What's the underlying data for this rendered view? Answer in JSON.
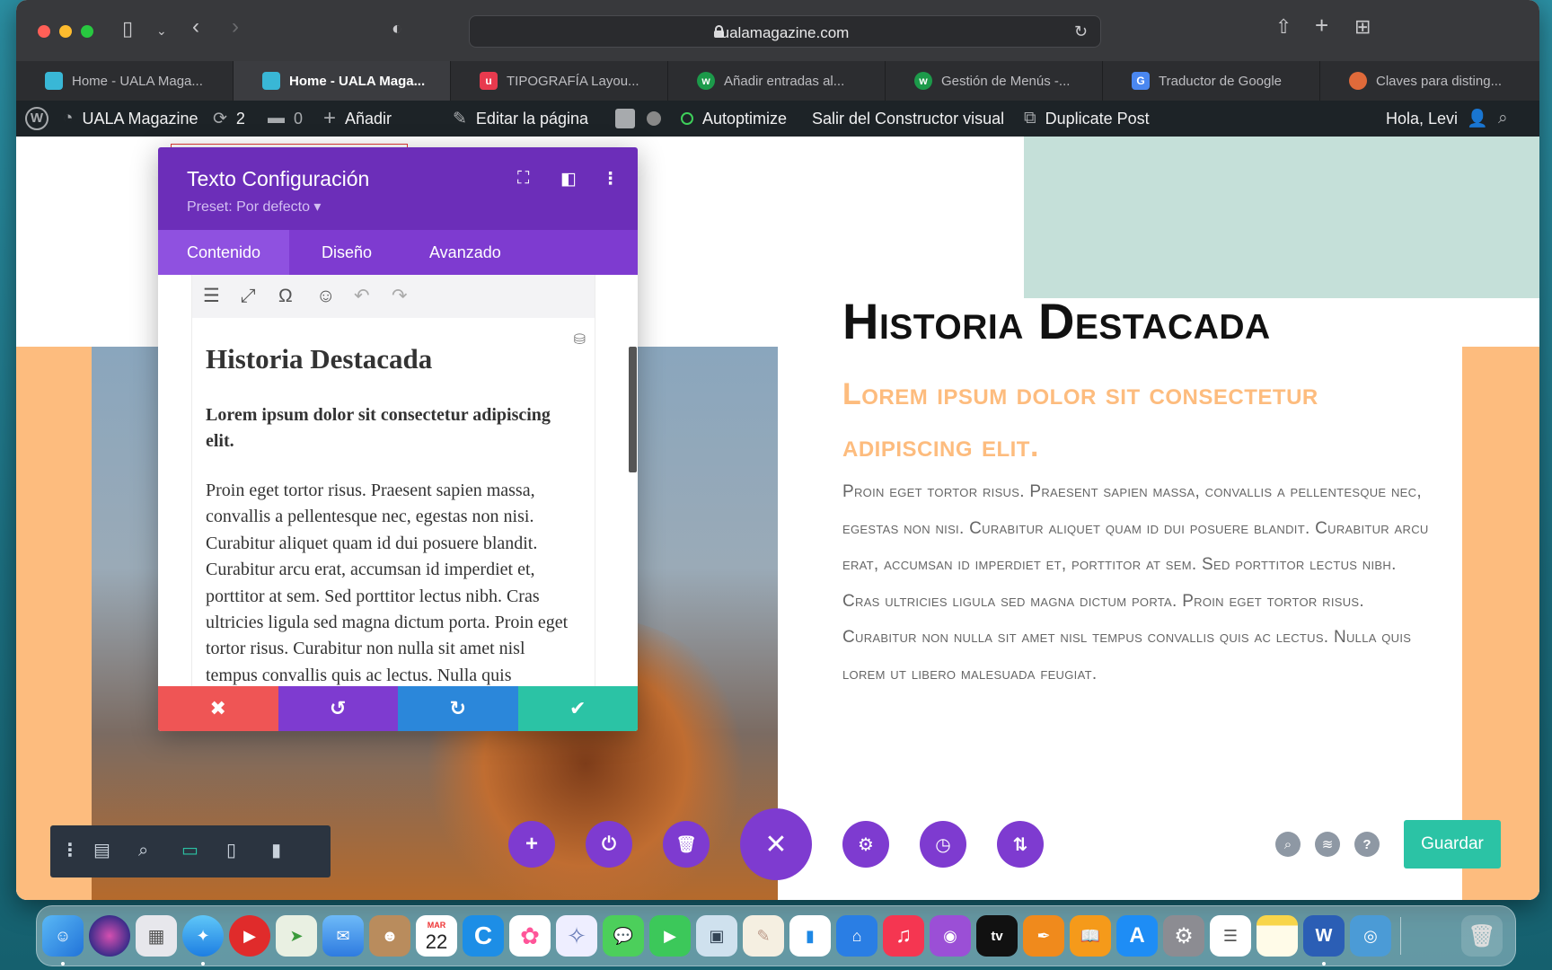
{
  "browser": {
    "url": "ualamagazine.com",
    "tabs": [
      {
        "label": "Home - UALA Maga...",
        "favicon": "#39b7d6",
        "active": false
      },
      {
        "label": "Home - UALA Maga...",
        "favicon": "#39b7d6",
        "active": true
      },
      {
        "label": "TIPOGRAFÍA Layou...",
        "favicon": "#e83a4e",
        "active": false
      },
      {
        "label": "Añadir entradas al...",
        "favicon": "#1c9a4a",
        "active": false
      },
      {
        "label": "Gestión de Menús -...",
        "favicon": "#1c9a4a",
        "active": false
      },
      {
        "label": "Traductor de Google",
        "favicon": "#4a87f0",
        "active": false
      },
      {
        "label": "Claves para disting...",
        "favicon": "#e06a3a",
        "active": false
      }
    ]
  },
  "adminbar": {
    "site_name": "UALA Magazine",
    "updates": "2",
    "comments": "0",
    "add": "Añadir",
    "edit": "Editar la página",
    "autoptimize": "Autoptimize",
    "exit_builder": "Salir del Constructor visual",
    "duplicate": "Duplicate Post",
    "greeting": "Hola, Levi"
  },
  "modal": {
    "title": "Texto Configuración",
    "preset": "Preset: Por defecto ▾",
    "tabs": [
      "Contenido",
      "Diseño",
      "Avanzado"
    ],
    "editor": {
      "heading": "Historia Destacada",
      "bold": "Lorem ipsum dolor sit consectetur adipiscing elit.",
      "paragraph": "Proin eget tortor risus. Praesent sapien massa, convallis a pellentesque nec, egestas non nisi. Curabitur aliquet quam id dui posuere blandit. Curabitur arcu erat, accumsan id imperdiet et, porttitor at sem. Sed porttitor lectus nibh. Cras ultricies ligula sed magna dictum porta. Proin eget tortor risus. Curabitur non nulla sit amet nisl tempus convallis quis ac lectus. Nulla quis"
    }
  },
  "preview": {
    "heading": "Historia Destacada",
    "subheading": "Lorem ipsum dolor sit consectetur adipiscing elit.",
    "body": "Proin eget tortor risus. Praesent sapien massa, convallis a pellentesque nec, egestas non nisi. Curabitur aliquet quam id dui posuere blandit. Curabitur arcu erat, accumsan id imperdiet et, porttitor at sem. Sed porttitor lectus nibh. Cras ultricies ligula sed magna dictum porta. Proin eget tortor risus. Curabitur non nulla sit amet nisl tempus convallis quis ac lectus. Nulla quis lorem ut libero malesuada feugiat."
  },
  "builder": {
    "save": "Guardar"
  },
  "colors": {
    "accent_purple": "#6c2eb9",
    "accent_orange": "#fdbc7e",
    "save_green": "#2bc3a5",
    "cancel_red": "#ef5555",
    "redo_blue": "#2b87da"
  },
  "dock": {
    "calendar_month": "MAR",
    "calendar_day": "22",
    "tv_label": "tv"
  }
}
